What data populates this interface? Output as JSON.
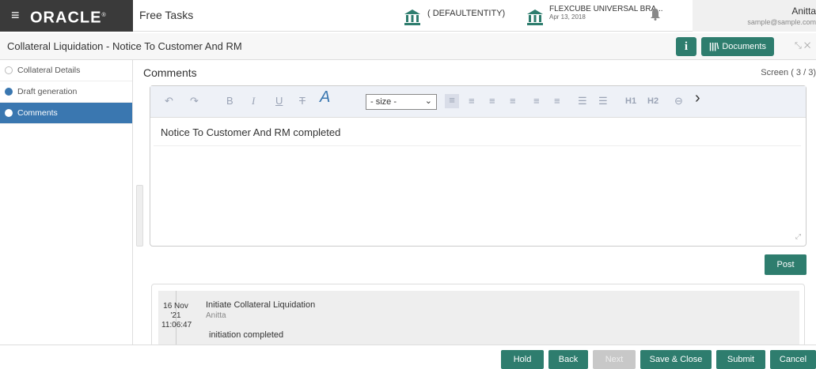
{
  "header": {
    "brand": "ORACLE",
    "brand_mark": "®",
    "menu_icon": "≡",
    "free_tasks": "Free Tasks",
    "entity": "( DEFAULTENTITY)",
    "branch_name": "FLEXCUBE UNIVERSAL BRA...",
    "branch_date": "Apr 13, 2018",
    "user_name": "Anitta",
    "user_email": "sample@sample.com"
  },
  "titlebar": {
    "title": "Collateral Liquidation - Notice To Customer And RM",
    "info_label": "i",
    "documents_label": "Documents",
    "minimize_icon": "⤡",
    "close_icon": "✕"
  },
  "sidebar": {
    "steps": [
      {
        "label": "Collateral Details"
      },
      {
        "label": "Draft generation"
      },
      {
        "label": "Comments"
      }
    ]
  },
  "main": {
    "title": "Comments",
    "screen": "Screen ( 3 / 3)"
  },
  "editor": {
    "size_placeholder": "- size -",
    "content": "Notice To Customer And RM completed",
    "toolbar": {
      "undo": "↶",
      "redo": "↷",
      "bold": "B",
      "italic": "I",
      "underline": "U",
      "strike": "T",
      "font": "A",
      "align_left": "≡",
      "align_center": "≡",
      "align_right": "≡",
      "justify": "≡",
      "indent": "≡",
      "outdent": "≡",
      "bullets": "☰",
      "numbers": "☰",
      "h1": "H1",
      "h2": "H2",
      "link": "⊖",
      "more": "›"
    }
  },
  "post_label": "Post",
  "comments": [
    {
      "date_day": "16 Nov",
      "date_year": "'21",
      "time": "11:06:47",
      "title": "Initiate Collateral Liquidation",
      "user": "Anitta",
      "text": "initiation completed"
    }
  ],
  "footer": {
    "hold": "Hold",
    "back": "Back",
    "next": "Next",
    "save_close": "Save & Close",
    "submit": "Submit",
    "cancel": "Cancel"
  },
  "colors": {
    "accent": "#2e7d6e",
    "sidebar_active": "#3a77b0",
    "brand_bg": "#3a3a3a"
  }
}
